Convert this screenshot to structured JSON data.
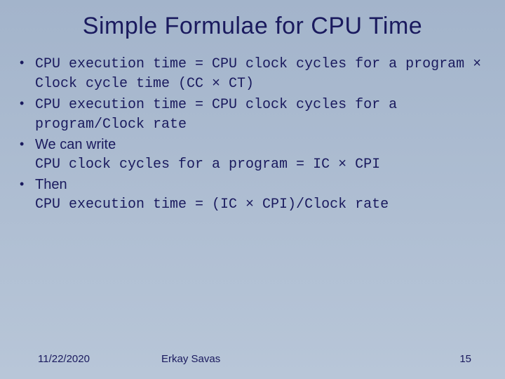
{
  "title": "Simple Formulae for CPU Time",
  "bullets": [
    {
      "intro": null,
      "body": "CPU execution time = \nCPU clock cycles for a program × Clock cycle time (CC × CT)"
    },
    {
      "intro": null,
      "body": "CPU execution time = \nCPU clock cycles for a program/Clock rate"
    },
    {
      "intro": "We can write",
      "body": "CPU clock cycles for a program = \nIC × CPI"
    },
    {
      "intro": "Then",
      "body": "CPU execution time = (IC × CPI)/Clock rate"
    }
  ],
  "footer": {
    "date": "11/22/2020",
    "author": "Erkay Savas",
    "page": "15"
  }
}
